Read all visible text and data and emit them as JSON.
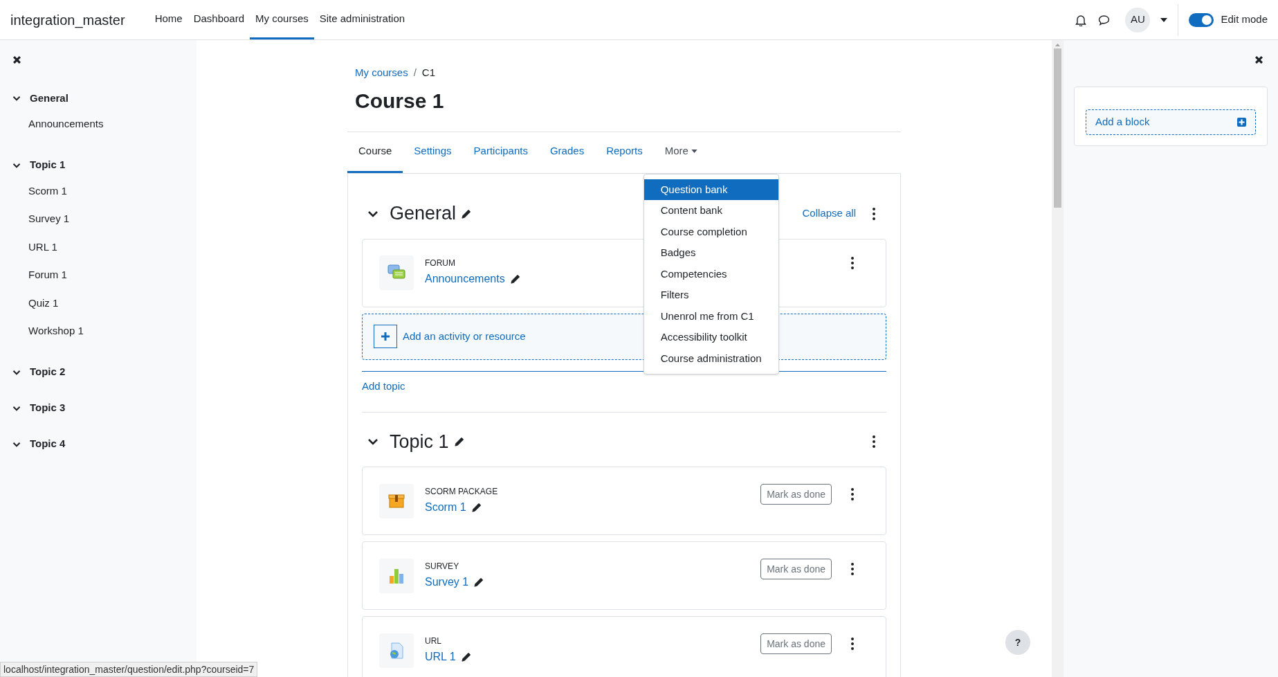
{
  "site_name": "integration_master",
  "nav": [
    {
      "label": "Home",
      "selected": false
    },
    {
      "label": "Dashboard",
      "selected": false
    },
    {
      "label": "My courses",
      "selected": true
    },
    {
      "label": "Site administration",
      "selected": false
    }
  ],
  "user_initials": "AU",
  "edit_mode": {
    "label": "Edit mode",
    "on": true
  },
  "course_index": [
    {
      "label": "General",
      "children": [
        {
          "label": "Announcements"
        }
      ]
    },
    {
      "label": "Topic 1",
      "children": [
        {
          "label": "Scorm 1"
        },
        {
          "label": "Survey 1"
        },
        {
          "label": "URL 1"
        },
        {
          "label": "Forum 1"
        },
        {
          "label": "Quiz 1"
        },
        {
          "label": "Workshop 1"
        }
      ]
    },
    {
      "label": "Topic 2"
    },
    {
      "label": "Topic 3"
    },
    {
      "label": "Topic 4"
    }
  ],
  "breadcrumb_separator": "/",
  "breadcrumb": [
    {
      "label": "My courses",
      "link": true
    },
    {
      "label": "C1",
      "link": false
    }
  ],
  "page_title": "Course 1",
  "tabs": [
    {
      "label": "Course",
      "selected": true
    },
    {
      "label": "Settings",
      "selected": false
    },
    {
      "label": "Participants",
      "selected": false
    },
    {
      "label": "Grades",
      "selected": false
    },
    {
      "label": "Reports",
      "selected": false
    },
    {
      "label": "More",
      "selected": false
    }
  ],
  "more_menu": [
    {
      "label": "Question bank",
      "selected": true
    },
    {
      "label": "Content bank",
      "selected": false
    },
    {
      "label": "Course completion",
      "selected": false
    },
    {
      "label": "Badges",
      "selected": false
    },
    {
      "label": "Competencies",
      "selected": false
    },
    {
      "label": "Filters",
      "selected": false
    },
    {
      "label": "Unenrol me from C1",
      "selected": false
    },
    {
      "label": "Accessibility toolkit",
      "selected": false
    },
    {
      "label": "Course administration",
      "selected": false
    }
  ],
  "collapse_all": "Collapse all",
  "sections": [
    {
      "title": "General",
      "add_activity": "Add an activity or resource",
      "add_topic": "Add topic",
      "activities": [
        {
          "kind": "forum",
          "type": "FORUM",
          "name": "Announcements"
        }
      ]
    },
    {
      "title": "Topic 1",
      "activities": [
        {
          "kind": "scorm",
          "type": "SCORM PACKAGE",
          "name": "Scorm 1",
          "completion": "Mark as done"
        },
        {
          "kind": "survey",
          "type": "SURVEY",
          "name": "Survey 1",
          "completion": "Mark as done"
        },
        {
          "kind": "url",
          "type": "URL",
          "name": "URL 1",
          "completion": "Mark as done"
        }
      ]
    }
  ],
  "add_block": "Add a block",
  "help": "?",
  "status_bar": "localhost/integration_master/question/edit.php?courseid=7"
}
